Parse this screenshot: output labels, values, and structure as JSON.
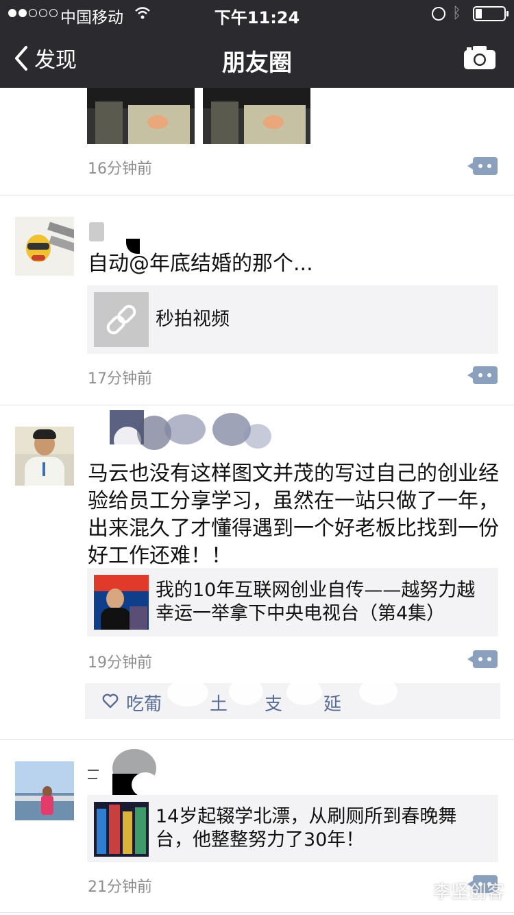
{
  "status": {
    "carrier": "中国移动",
    "time": "下午11:24"
  },
  "nav": {
    "back_label": "发现",
    "title": "朋友圈"
  },
  "posts": [
    {
      "time_ago": "16分钟前"
    },
    {
      "name": "",
      "text": "自动@年底结婚的那个...",
      "link_title": "秒拍视频",
      "time_ago": "17分钟前"
    },
    {
      "name": "",
      "text": "马云也没有这样图文并茂的写过自己的创业经验给员工分享学习，虽然在一站只做了一年，出来混久了才懂得遇到一个好老板比找到一份好工作还难！！",
      "link_title": "我的10年互联网创业自传——越努力越幸运一举拿下中央电视台（第4集）",
      "time_ago": "19分钟前",
      "likes": [
        "吃葡",
        "土",
        "支",
        "延"
      ]
    },
    {
      "name": "",
      "link_title": "14岁起辍学北漂，从刷厕所到春晚舞台，他整整努力了30年！",
      "time_ago": "21分钟前"
    }
  ],
  "watermark": "李坚创客",
  "colors": {
    "header_bg": "#2b2b2f",
    "name_blue": "#576b95",
    "card_bg": "#f3f3f5",
    "time_grey": "#8e8e8e"
  },
  "icons": [
    "back-chevron-icon",
    "camera-icon",
    "wifi-icon",
    "alarm-icon",
    "bluetooth-icon",
    "battery-icon",
    "link-icon",
    "comment-more-icon",
    "heart-icon"
  ]
}
